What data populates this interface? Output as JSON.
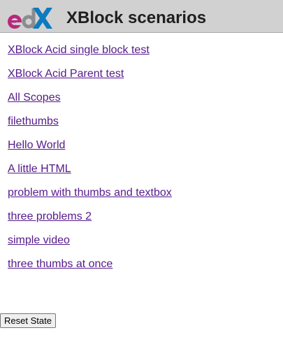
{
  "header": {
    "logo": "edX",
    "title": "XBlock scenarios",
    "colors": {
      "logo_e": "#b8287c",
      "logo_d": "#8a8c8f",
      "logo_x": "#0d7bbf",
      "header_bg": "#d1d1d1",
      "link": "#551a8b"
    }
  },
  "scenarios": [
    {
      "label": "XBlock Acid single block test"
    },
    {
      "label": "XBlock Acid Parent test"
    },
    {
      "label": "All Scopes"
    },
    {
      "label": "filethumbs"
    },
    {
      "label": "Hello World"
    },
    {
      "label": "A little HTML"
    },
    {
      "label": "problem with thumbs and textbox"
    },
    {
      "label": "three problems 2"
    },
    {
      "label": "simple video"
    },
    {
      "label": "three thumbs at once"
    }
  ],
  "reset_button": {
    "label": "Reset State"
  }
}
